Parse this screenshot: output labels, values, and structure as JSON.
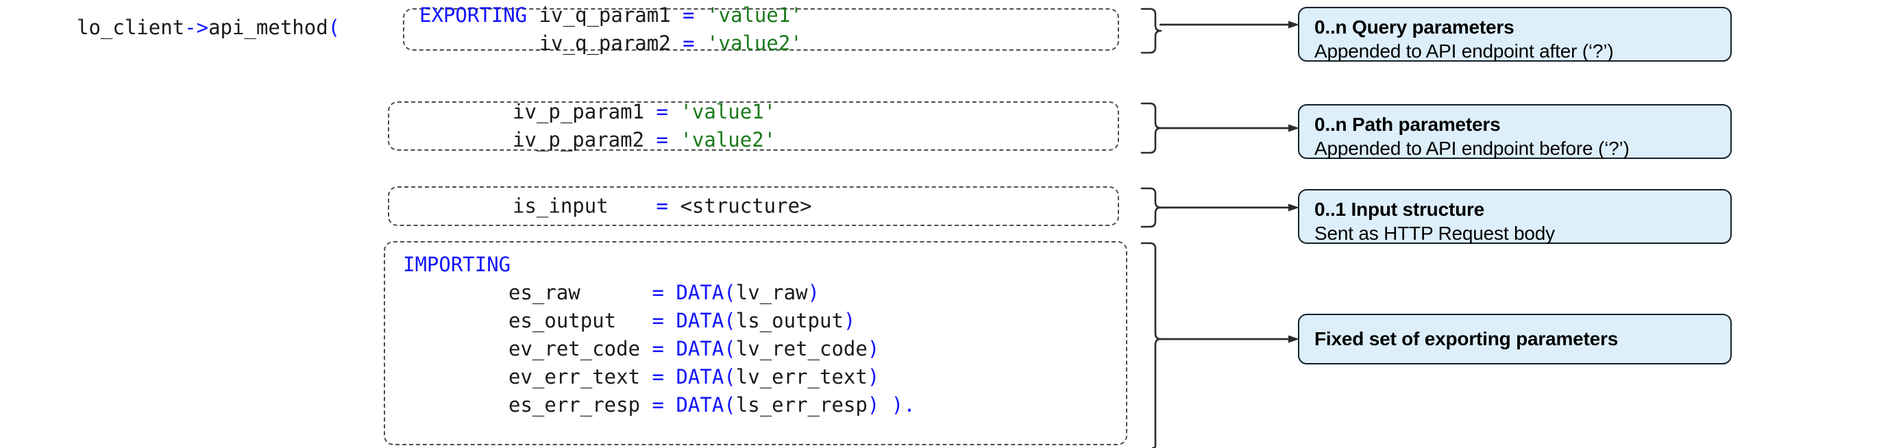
{
  "diagram": {
    "title": "ABAP API client method parameter diagram",
    "colors": {
      "keyword": "#1414ff",
      "string": "#1a7a1a",
      "code_text": "#1a1a1a",
      "callout_fill": "#ddeffb",
      "callout_border": "#12202b",
      "connector": "#2b2b2b",
      "box_border": "#4d4d4d"
    }
  },
  "call_head": {
    "object": "lo_client",
    "arrow": "->",
    "method": "api_method",
    "open_paren": "("
  },
  "code_blocks": [
    {
      "id": "query",
      "keyword": "EXPORTING",
      "lines": [
        {
          "name": "iv_q_param1",
          "eq": "=",
          "value": "'value1'",
          "value_kind": "string"
        },
        {
          "name": "iv_q_param2",
          "eq": "=",
          "value": "'value2'",
          "value_kind": "string"
        }
      ]
    },
    {
      "id": "path",
      "keyword": "",
      "lines": [
        {
          "name": "iv_p_param1",
          "eq": "=",
          "value": "'value1'",
          "value_kind": "string"
        },
        {
          "name": "iv_p_param2",
          "eq": "=",
          "value": "'value2'",
          "value_kind": "string"
        }
      ]
    },
    {
      "id": "input",
      "keyword": "",
      "lines": [
        {
          "name": "is_input",
          "eq": "=",
          "value": "<structure>",
          "value_kind": "plain"
        }
      ]
    },
    {
      "id": "importing",
      "keyword": "IMPORTING",
      "lines": [
        {
          "name": "es_raw",
          "eq": "=",
          "fn": "DATA(",
          "arg": "lv_raw",
          "close": ")",
          "value_kind": "data"
        },
        {
          "name": "es_output",
          "eq": "=",
          "fn": "DATA(",
          "arg": "ls_output",
          "close": ")",
          "value_kind": "data"
        },
        {
          "name": "ev_ret_code",
          "eq": "=",
          "fn": "DATA(",
          "arg": "lv_ret_code",
          "close": ")",
          "value_kind": "data"
        },
        {
          "name": "ev_err_text",
          "eq": "=",
          "fn": "DATA(",
          "arg": "lv_err_text",
          "close": ")",
          "value_kind": "data"
        },
        {
          "name": "es_err_resp",
          "eq": "=",
          "fn": "DATA(",
          "arg": "ls_err_resp",
          "close": ") ).",
          "value_kind": "data"
        }
      ]
    }
  ],
  "code_text": {
    "head_line": "lo_client->api_method(",
    "query_line_1": "EXPORTING iv_q_param1 = 'value1'",
    "query_line_2": "          iv_q_param2 = 'value2'",
    "path_line_1": "iv_p_param1 = 'value1'",
    "path_line_2": "iv_p_param2 = 'value2'",
    "input_line_1": "is_input    = <structure>",
    "importing_keyword": "IMPORTING",
    "importing_line_1": "es_raw      = DATA(lv_raw)",
    "importing_line_2": "es_output   = DATA(ls_output)",
    "importing_line_3": "ev_ret_code = DATA(lv_ret_code)",
    "importing_line_4": "ev_err_text = DATA(lv_err_text)",
    "importing_line_5": "es_err_resp = DATA(ls_err_resp) )."
  },
  "callouts": [
    {
      "id": "query",
      "title": "0..n Query parameters",
      "subtitle": "Appended to API endpoint after (‘?’)"
    },
    {
      "id": "path",
      "title": "0..n Path parameters",
      "subtitle": "Appended to API endpoint before (‘?’)"
    },
    {
      "id": "input",
      "title": "0..1 Input structure",
      "subtitle": "Sent as HTTP Request body"
    },
    {
      "id": "fixed",
      "title": "Fixed set of exporting parameters",
      "subtitle": ""
    }
  ],
  "connectors": [
    {
      "id": "brace-query",
      "icon": "curly-brace-right"
    },
    {
      "id": "brace-path",
      "icon": "curly-brace-right"
    },
    {
      "id": "brace-input",
      "icon": "curly-brace-right"
    },
    {
      "id": "brace-fixed",
      "icon": "curly-brace-right"
    },
    {
      "id": "arrow-query",
      "icon": "arrow-right"
    },
    {
      "id": "arrow-path",
      "icon": "arrow-right"
    },
    {
      "id": "arrow-input",
      "icon": "arrow-right"
    },
    {
      "id": "arrow-fixed",
      "icon": "arrow-right"
    }
  ]
}
